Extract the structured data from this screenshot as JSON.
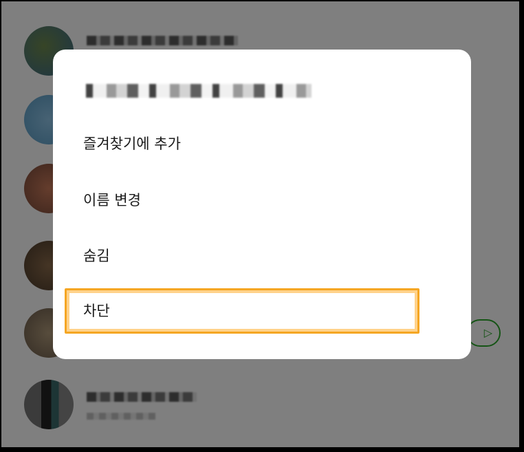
{
  "dialog": {
    "menu_items": [
      {
        "label": "즐겨찾기에 추가"
      },
      {
        "label": "이름 변경"
      },
      {
        "label": "숨김"
      },
      {
        "label": "차단"
      }
    ]
  },
  "colors": {
    "highlight": "#f5a623",
    "play_button": "#2aa82a",
    "dialog_bg": "#ffffff"
  },
  "icons": {
    "play": "play-icon"
  },
  "play_button": {
    "glyph": "▷"
  }
}
